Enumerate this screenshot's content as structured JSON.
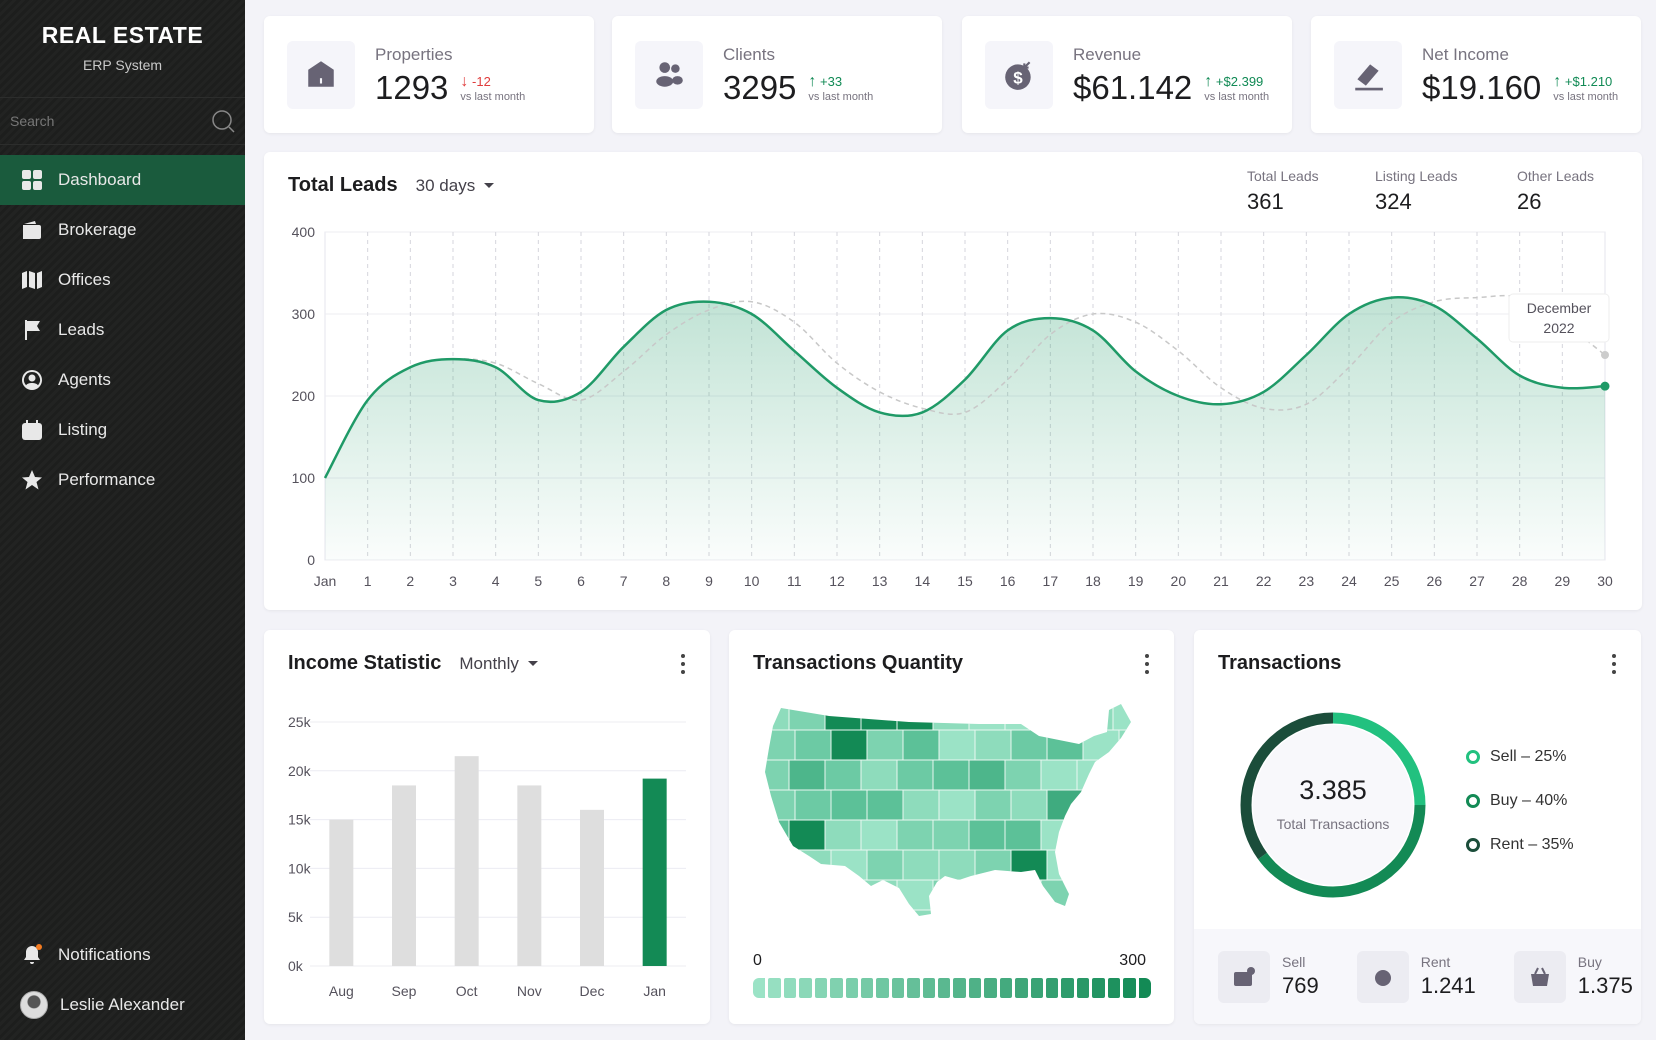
{
  "sidebar": {
    "title": "REAL ESTATE",
    "subtitle": "ERP System",
    "search_placeholder": "Search",
    "items": [
      {
        "label": "Dashboard",
        "icon": "grid-icon",
        "active": true
      },
      {
        "label": "Brokerage",
        "icon": "wallet-icon"
      },
      {
        "label": "Offices",
        "icon": "map-icon"
      },
      {
        "label": "Leads",
        "icon": "flag-icon"
      },
      {
        "label": "Agents",
        "icon": "user-circle-icon"
      },
      {
        "label": "Listing",
        "icon": "calendar-icon"
      },
      {
        "label": "Performance",
        "icon": "star-icon"
      }
    ],
    "notifications": "Notifications",
    "user": "Leslie Alexander"
  },
  "kpis": [
    {
      "label": "Properties",
      "value": "1293",
      "delta": "-12",
      "dir": "down",
      "sub": "vs last month",
      "icon": "house-icon"
    },
    {
      "label": "Clients",
      "value": "3295",
      "delta": "+33",
      "dir": "up",
      "sub": "vs last month",
      "icon": "users-icon"
    },
    {
      "label": "Revenue",
      "value": "$61.142",
      "delta": "+$2.399",
      "dir": "up",
      "sub": "vs last month",
      "icon": "money-icon"
    },
    {
      "label": "Net Income",
      "value": "$19.160",
      "delta": "+$1.210",
      "dir": "up",
      "sub": "vs last month",
      "icon": "pen-icon"
    }
  ],
  "leads": {
    "title": "Total Leads",
    "range": "30 days",
    "stats": [
      {
        "label": "Total Leads",
        "value": "361"
      },
      {
        "label": "Listing Leads",
        "value": "324"
      },
      {
        "label": "Other Leads",
        "value": "26"
      }
    ],
    "tooltip_line1": "December",
    "tooltip_line2": "2022"
  },
  "income": {
    "title": "Income Statistic",
    "range": "Monthly"
  },
  "map": {
    "title": "Transactions Quantity",
    "min_label": "0",
    "max_label": "300",
    "colors": {
      "low": "#9be3c6",
      "high": "#138a55"
    }
  },
  "transactions": {
    "title": "Transactions",
    "total": "3.385",
    "total_label": "Total Transactions",
    "legend": [
      {
        "label": "Sell – 25%",
        "pct": 25,
        "color": "#22c17f"
      },
      {
        "label": "Buy – 40%",
        "pct": 40,
        "color": "#138a55"
      },
      {
        "label": "Rent – 35%",
        "pct": 35,
        "color": "#1b4d3a"
      }
    ],
    "footer": [
      {
        "label": "Sell",
        "value": "769",
        "icon": "card-icon"
      },
      {
        "label": "Rent",
        "value": "1.241",
        "icon": "alarm-icon"
      },
      {
        "label": "Buy",
        "value": "1.375",
        "icon": "basket-icon"
      }
    ]
  },
  "chart_data": [
    {
      "type": "area",
      "x": [
        "Jan",
        "1",
        "2",
        "3",
        "4",
        "5",
        "6",
        "7",
        "8",
        "9",
        "10",
        "11",
        "12",
        "13",
        "14",
        "15",
        "16",
        "17",
        "18",
        "19",
        "20",
        "21",
        "22",
        "23",
        "24",
        "25",
        "26",
        "27",
        "28",
        "29",
        "30"
      ],
      "ylim": [
        0,
        400
      ],
      "yticks": [
        0,
        100,
        200,
        300,
        400
      ],
      "grid": true,
      "series": [
        {
          "style": "solid",
          "color": "#1f9a67",
          "values": [
            100,
            195,
            235,
            245,
            235,
            195,
            205,
            260,
            305,
            315,
            300,
            255,
            210,
            180,
            180,
            220,
            280,
            295,
            280,
            230,
            200,
            190,
            205,
            250,
            300,
            320,
            310,
            270,
            225,
            210,
            212
          ]
        },
        {
          "style": "dashed",
          "color": "#c8c8c8",
          "values": [
            100,
            195,
            235,
            245,
            240,
            215,
            195,
            230,
            275,
            305,
            315,
            290,
            240,
            205,
            185,
            180,
            220,
            275,
            300,
            290,
            255,
            210,
            185,
            190,
            235,
            290,
            315,
            320,
            320,
            290,
            250
          ]
        }
      ]
    },
    {
      "type": "bar",
      "categories": [
        "Aug",
        "Sep",
        "Oct",
        "Nov",
        "Dec",
        "Jan"
      ],
      "values": [
        15000,
        18500,
        21500,
        18500,
        16000,
        19200
      ],
      "ylim": [
        0,
        25000
      ],
      "yticks": [
        "0k",
        "5k",
        "10k",
        "15k",
        "20k",
        "25k"
      ],
      "highlight": "Jan",
      "colors": {
        "bar": "#dedede",
        "highlight": "#138a55"
      }
    }
  ]
}
